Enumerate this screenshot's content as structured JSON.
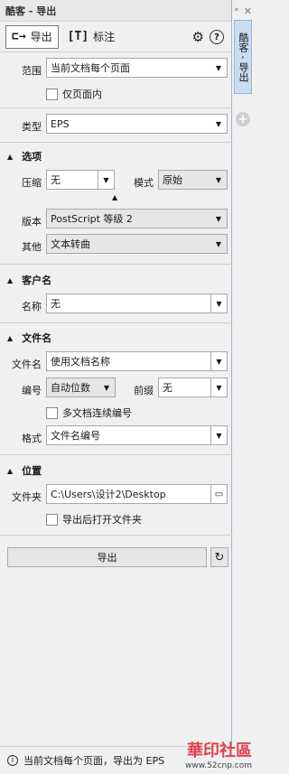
{
  "title": "酷客 - 导出",
  "tabs": [
    {
      "icon": "export-icon",
      "label": "导出"
    },
    {
      "icon": "text-T-icon",
      "label": "标注"
    }
  ],
  "range": {
    "label": "范围",
    "value": "当前文档每个页面",
    "page_only": "仅页面内"
  },
  "type": {
    "label": "类型",
    "value": "EPS"
  },
  "options": {
    "header": "选项",
    "compress_label": "压缩",
    "compress_value": "无",
    "mode_label": "模式",
    "mode_value": "原始",
    "version_label": "版本",
    "version_value": "PostScript 等级 2",
    "other_label": "其他",
    "other_value": "文本转曲"
  },
  "client": {
    "header": "客户名",
    "name_label": "名称",
    "name_value": "无"
  },
  "filename": {
    "header": "文件名",
    "name_label": "文件名",
    "name_value": "使用文档名称",
    "number_label": "编号",
    "number_value": "自动位数",
    "prefix_label": "前缀",
    "prefix_value": "无",
    "multi_doc": "多文档连续编号",
    "format_label": "格式",
    "format_value": "文件名编号"
  },
  "location": {
    "header": "位置",
    "folder_label": "文件夹",
    "folder_value": "C:\\Users\\设计2\\Desktop",
    "open_after": "导出后打开文件夹"
  },
  "export_button": "导出",
  "status_text": "当前文档每个页面，导出为 EPS",
  "side_tab": "酷客 - 导出",
  "watermark": {
    "brand": "華印社區",
    "url": "www.52cnp.com"
  }
}
